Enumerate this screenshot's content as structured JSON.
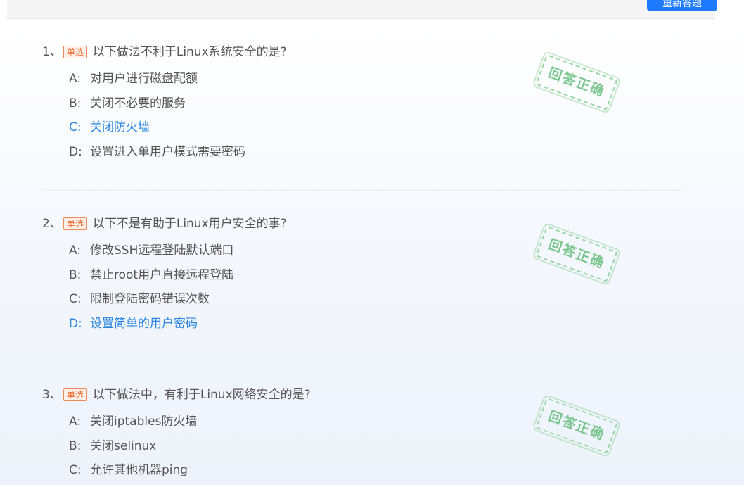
{
  "header": {
    "redo_label": "重新答题"
  },
  "questions": [
    {
      "number": "1、",
      "tag": "单选",
      "text": "以下做法不利于Linux系统安全的是?",
      "stamp": "回答正确",
      "options": [
        {
          "letter": "A:",
          "text": "对用户进行磁盘配额",
          "correct": false
        },
        {
          "letter": "B:",
          "text": "关闭不必要的服务",
          "correct": false
        },
        {
          "letter": "C:",
          "text": "关闭防火墙",
          "correct": true
        },
        {
          "letter": "D:",
          "text": "设置进入单用户模式需要密码",
          "correct": false
        }
      ]
    },
    {
      "number": "2、",
      "tag": "单选",
      "text": "以下不是有助于Linux用户安全的事?",
      "stamp": "回答正确",
      "options": [
        {
          "letter": "A:",
          "text": "修改SSH远程登陆默认端口",
          "correct": false
        },
        {
          "letter": "B:",
          "text": "禁止root用户直接远程登陆",
          "correct": false
        },
        {
          "letter": "C:",
          "text": "限制登陆密码错误次数",
          "correct": false
        },
        {
          "letter": "D:",
          "text": "设置简单的用户密码",
          "correct": true
        }
      ]
    },
    {
      "number": "3、",
      "tag": "单选",
      "text": "以下做法中，有利于Linux网络安全的是?",
      "stamp": "回答正确",
      "options": [
        {
          "letter": "A:",
          "text": "关闭iptables防火墙",
          "correct": false
        },
        {
          "letter": "B:",
          "text": "关闭selinux",
          "correct": false
        },
        {
          "letter": "C:",
          "text": "允许其他机器ping",
          "correct": false
        }
      ]
    }
  ]
}
